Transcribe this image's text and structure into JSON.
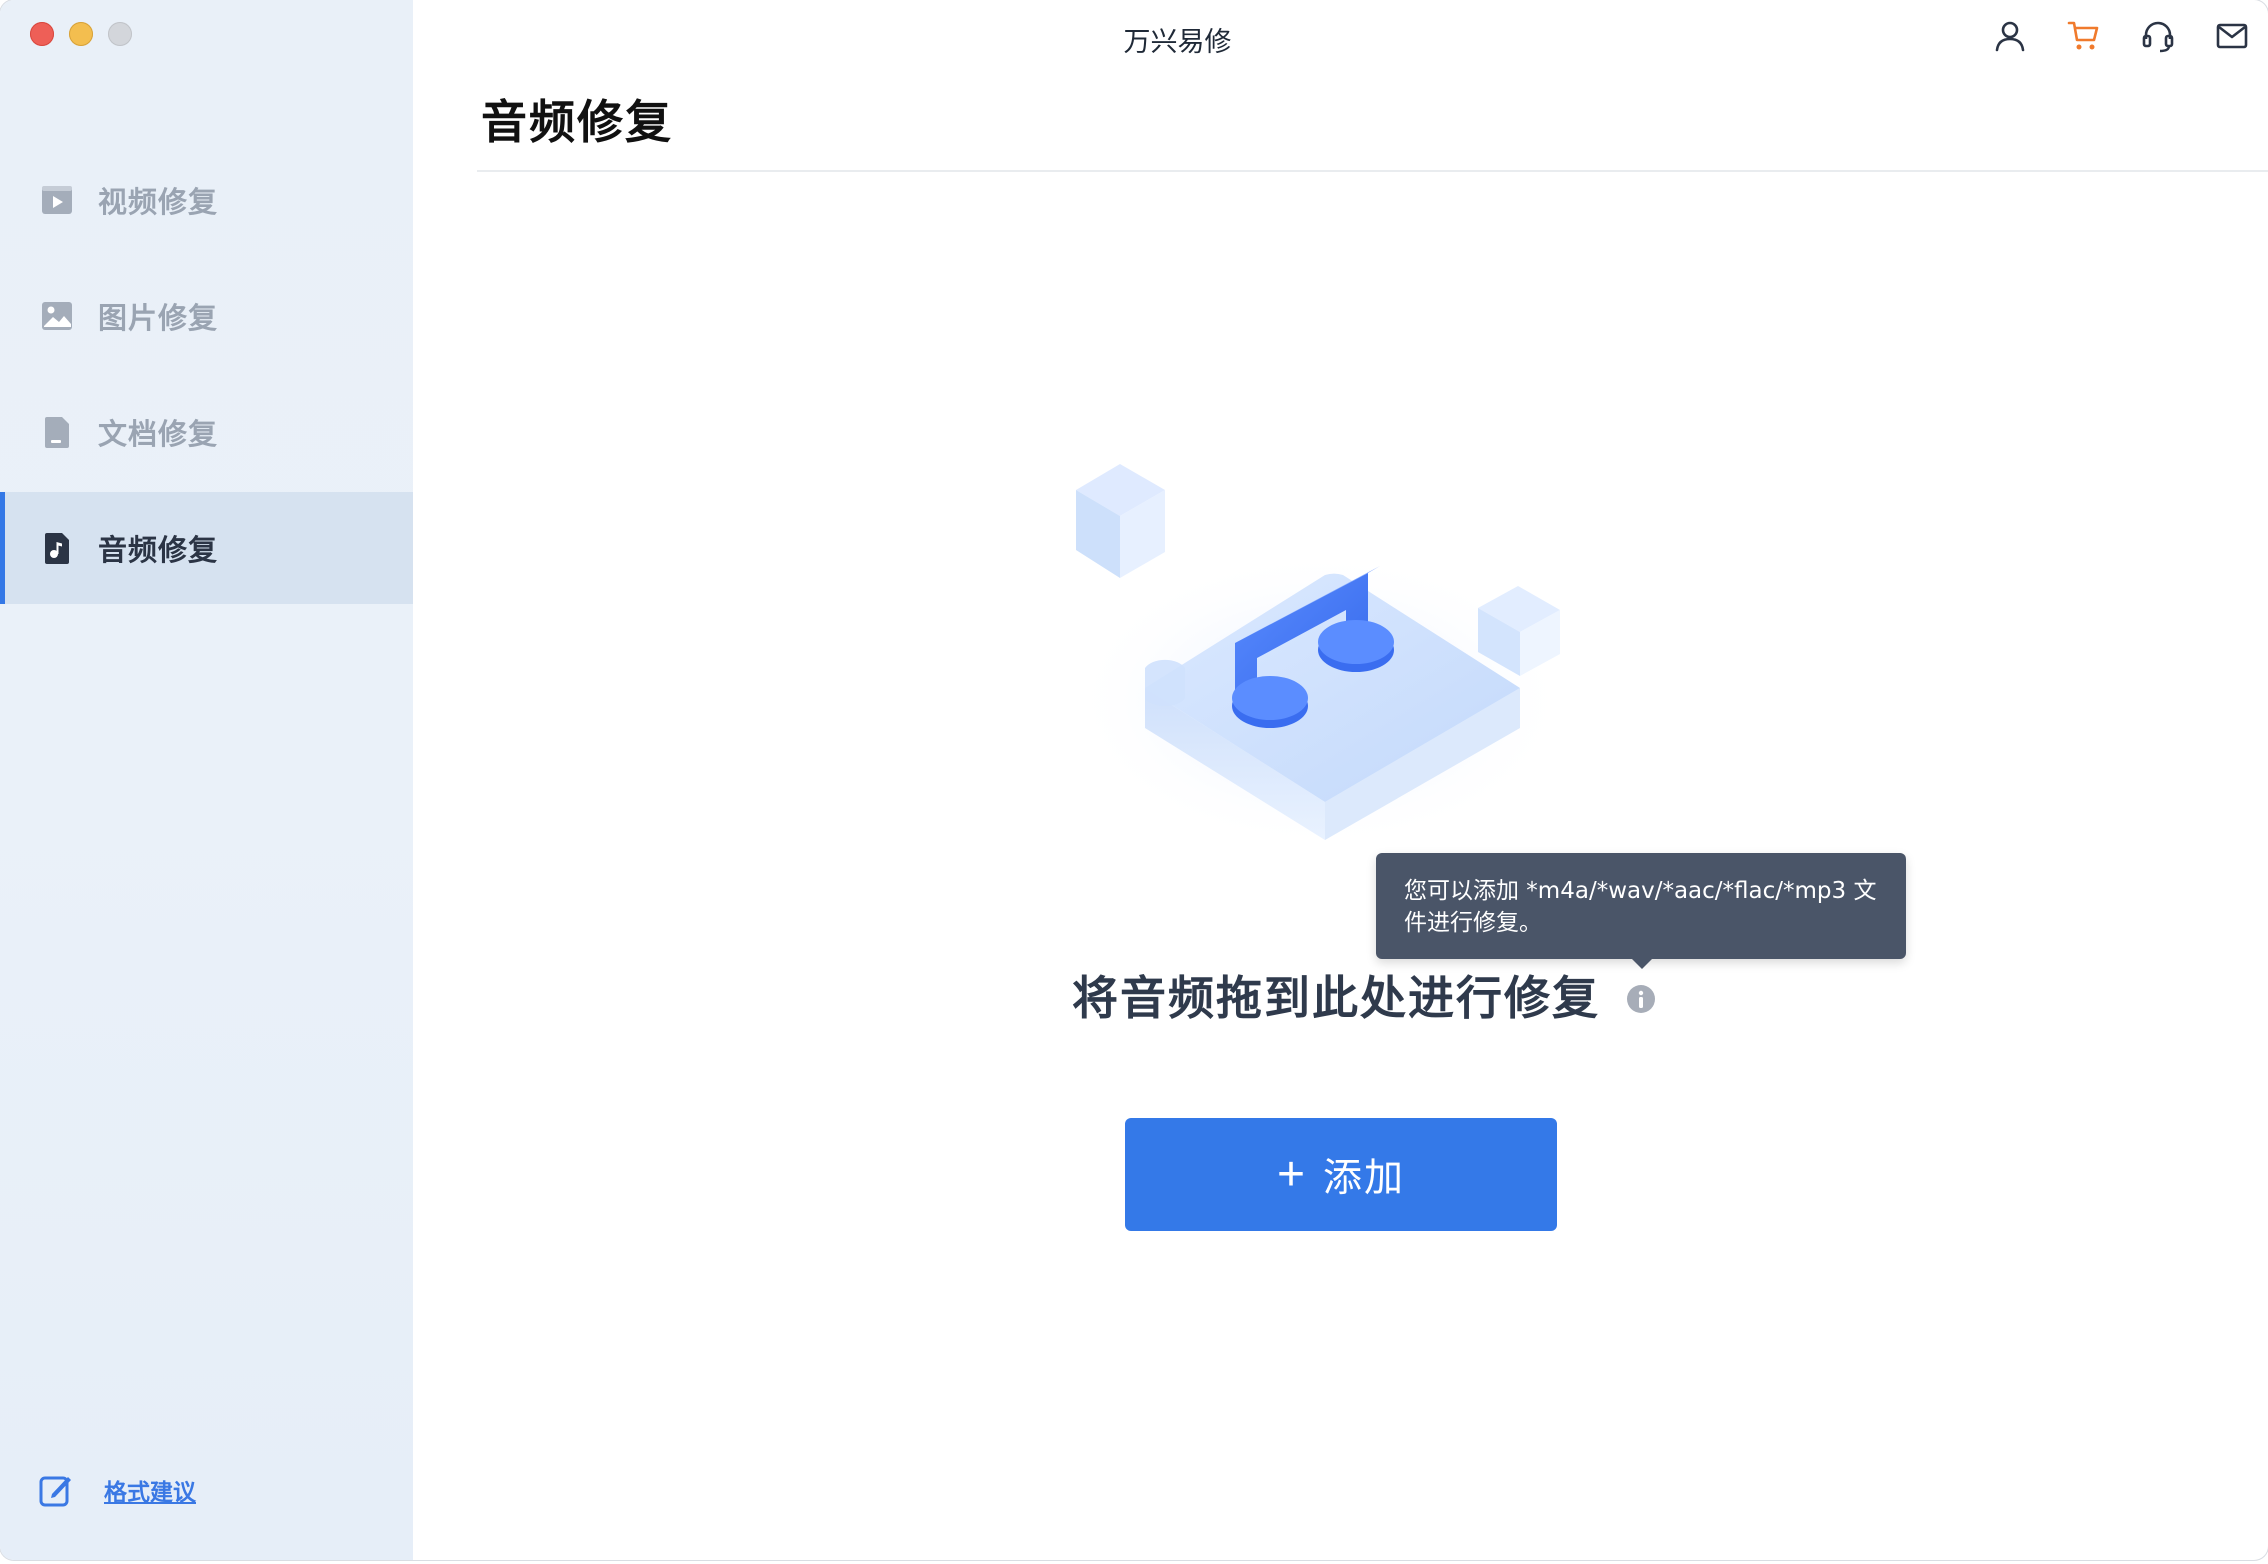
{
  "window": {
    "title": "万兴易修"
  },
  "sidebar": {
    "items": [
      {
        "label": "视频修复",
        "icon": "video-icon",
        "active": false
      },
      {
        "label": "图片修复",
        "icon": "image-icon",
        "active": false
      },
      {
        "label": "文档修复",
        "icon": "document-icon",
        "active": false
      },
      {
        "label": "音频修复",
        "icon": "audio-file-icon",
        "active": true
      }
    ],
    "feedback_label": "格式建议"
  },
  "header": {
    "icons": [
      "user-icon",
      "cart-icon",
      "headset-icon",
      "mail-icon"
    ]
  },
  "main": {
    "page_title": "音频修复",
    "drop_text": "将音频拖到此处进行修复",
    "tooltip_line1": "您可以添加 *m4a/*wav/*aac/*flac/*mp3 文",
    "tooltip_line2": "件进行修复。",
    "add_button_label": "添加",
    "add_button_plus": "+"
  },
  "colors": {
    "accent": "#3479e8",
    "sidebar_active": "#d6e2f0",
    "cart": "#f07a2c",
    "tooltip_bg": "#4a5568"
  }
}
